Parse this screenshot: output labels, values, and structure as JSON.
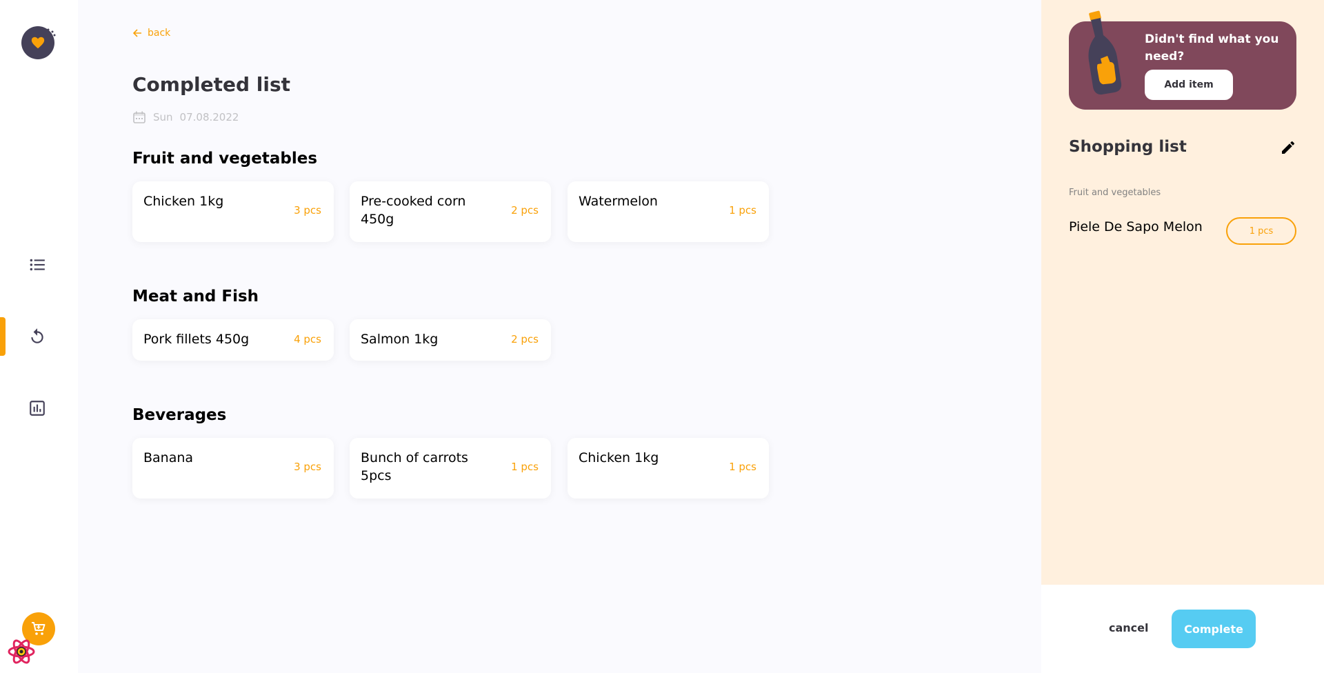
{
  "nav": {
    "logo_icon": "logo-icon",
    "items": [
      {
        "name": "list-icon",
        "active": false
      },
      {
        "name": "history-icon",
        "active": true
      },
      {
        "name": "statistics-icon",
        "active": false
      }
    ],
    "cart_icon": "cart-icon",
    "accent_color": "#f9a109"
  },
  "main": {
    "back_label": "back",
    "title": "Completed list",
    "date_day": "Sun",
    "date_value": "07.08.2022",
    "sections": [
      {
        "title": "Fruit and vegetables",
        "items": [
          {
            "name": "Chicken 1kg",
            "qty": "3 pcs"
          },
          {
            "name": "Pre-cooked corn 450g",
            "qty": "2 pcs"
          },
          {
            "name": "Watermelon",
            "qty": "1 pcs"
          }
        ]
      },
      {
        "title": "Meat and Fish",
        "items": [
          {
            "name": "Pork fillets 450g",
            "qty": "4 pcs"
          },
          {
            "name": "Salmon 1kg",
            "qty": "2 pcs"
          }
        ]
      },
      {
        "title": "Beverages",
        "items": [
          {
            "name": "Banana",
            "qty": "3 pcs"
          },
          {
            "name": "Bunch of carrots 5pcs",
            "qty": "1 pcs"
          },
          {
            "name": "Chicken 1kg",
            "qty": "1 pcs"
          }
        ]
      }
    ]
  },
  "side": {
    "promo_text": "Didn't find what you need?",
    "add_item_label": "Add item",
    "list_title": "Shopping list",
    "category": "Fruit and vegetables",
    "item_name": "Piele De Sapo Melon",
    "item_qty": "1 pcs",
    "cancel_label": "cancel",
    "complete_label": "Complete",
    "panel_color": "#fff0de",
    "promo_color": "#80485b",
    "complete_color": "#56ccf2"
  }
}
